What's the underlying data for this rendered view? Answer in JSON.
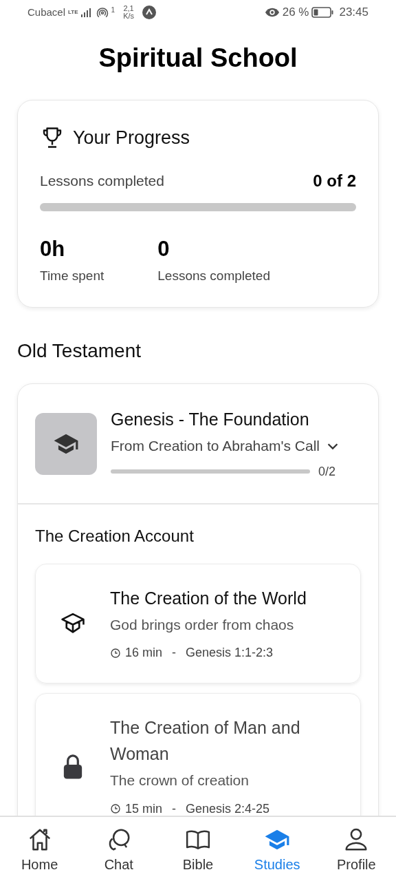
{
  "status_bar": {
    "carrier": "Cubacel",
    "network": "LTE",
    "hotspot_count": "1",
    "speed_value": "2,1",
    "speed_unit": "K/s",
    "battery": "26 %",
    "time": "23:45"
  },
  "title": "Spiritual School",
  "progress": {
    "heading": "Your Progress",
    "label": "Lessons completed",
    "count": "0 of 2",
    "level": 0,
    "stats": [
      {
        "value": "0h",
        "label": "Time spent"
      },
      {
        "value": "0",
        "label": "Lessons completed"
      }
    ]
  },
  "section": "Old Testament",
  "course": {
    "title": "Genesis - The Foundation",
    "subtitle": "From Creation to Abraham's Call",
    "expanded": true,
    "level": 0,
    "count": "0/2",
    "group": "The Creation Account",
    "lessons": [
      {
        "kind": "open",
        "title": "The Creation of the World",
        "description": "God brings order from chaos",
        "duration": "16 min",
        "separator": "-",
        "reference": "Genesis 1:1-2:3"
      },
      {
        "kind": "locked",
        "title": "The Creation of Man and Woman",
        "description": "The crown of creation",
        "duration": "15 min",
        "separator": "-",
        "reference": "Genesis 2:4-25"
      }
    ]
  },
  "nav": [
    {
      "label": "Home",
      "kind": "home",
      "selected": false
    },
    {
      "label": "Chat",
      "kind": "chat",
      "selected": false
    },
    {
      "label": "Bible",
      "kind": "book",
      "selected": false
    },
    {
      "label": "Studies",
      "kind": "cap",
      "selected": true
    },
    {
      "label": "Profile",
      "kind": "person",
      "selected": false
    }
  ]
}
